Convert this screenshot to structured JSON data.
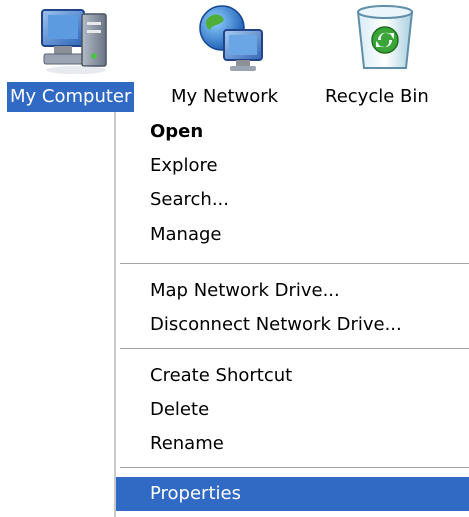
{
  "desktop": {
    "icons": [
      {
        "label": "My Computer",
        "icon": "my-computer-icon",
        "selected": true
      },
      {
        "label": "My Network",
        "icon": "my-network-icon",
        "selected": false
      },
      {
        "label": "Recycle Bin",
        "icon": "recycle-bin-icon",
        "selected": false
      }
    ]
  },
  "context_menu": {
    "items": [
      {
        "label": "Open",
        "default": true
      },
      {
        "label": "Explore"
      },
      {
        "label": "Search..."
      },
      {
        "label": "Manage"
      },
      {
        "label": "Map Network Drive..."
      },
      {
        "label": "Disconnect Network Drive..."
      },
      {
        "label": "Create Shortcut"
      },
      {
        "label": "Delete"
      },
      {
        "label": "Rename"
      },
      {
        "label": "Properties",
        "highlighted": true
      }
    ]
  },
  "colors": {
    "selection": "#316ac5",
    "selection_text": "#ffffff",
    "menu_background": "#ffffff",
    "separator": "#a6a6a6"
  }
}
